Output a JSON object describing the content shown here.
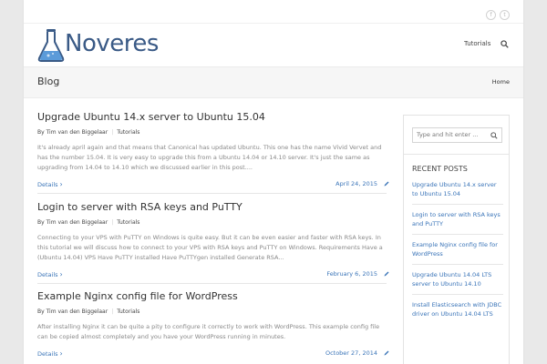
{
  "brand": {
    "name": "Noveres",
    "color": "#3a5a86",
    "accent": "#3a74b8"
  },
  "social": {
    "facebook_icon": "f",
    "twitter_icon": "t"
  },
  "nav": {
    "items": [
      "Tutorials"
    ]
  },
  "titlebar": {
    "title": "Blog",
    "breadcrumb": "Home"
  },
  "posts": [
    {
      "title": "Upgrade Ubuntu 14.x server to Ubuntu 15.04",
      "author": "By Tim van den Biggelaar",
      "category": "Tutorials",
      "excerpt": "It's already april again and that means that Canonical has updated Ubuntu. This one has the name Vivid Vervet and has the number 15.04. It is very easy to upgrade this from a Ubuntu 14.04 or 14.10 server. It's just the same as upgrading from 14.04 to 14.10 which we discussed earlier in this post....",
      "details_label": "Details",
      "date": "April 24, 2015"
    },
    {
      "title": "Login to server with RSA keys and PuTTY",
      "author": "By Tim van den Biggelaar",
      "category": "Tutorials",
      "excerpt": "Connecting to your VPS with PuTTY on Windows is quite easy. But it can be even easier and faster with RSA keys. In this tutorial we will discuss how to connect to your VPS with RSA keys and PuTTY on Windows. Requirements Have a (Ubuntu 14.04) VPS Have PuTTY installed Have PuTTYgen installed Generate RSA...",
      "details_label": "Details",
      "date": "February 6, 2015"
    },
    {
      "title": "Example Nginx config file for WordPress",
      "author": "By Tim van den Biggelaar",
      "category": "Tutorials",
      "excerpt": "After installing Nginx it can be quite a pity to configure it correctly to work with WordPress. This example config file can be copied almost completely and you have your WordPress running in minutes.",
      "details_label": "Details",
      "date": "October 27, 2014"
    }
  ],
  "sidebar": {
    "search_placeholder": "Type and hit enter ...",
    "recent_title": "RECENT POSTS",
    "recent_posts": [
      "Upgrade Ubuntu 14.x server to Ubuntu 15.04",
      "Login to server with RSA keys and PuTTY",
      "Example Nginx config file for WordPress",
      "Upgrade Ubuntu 14.04 LTS server to Ubuntu 14.10",
      "Install Elasticsearch with JDBC driver on Ubuntu 14.04 LTS"
    ]
  }
}
